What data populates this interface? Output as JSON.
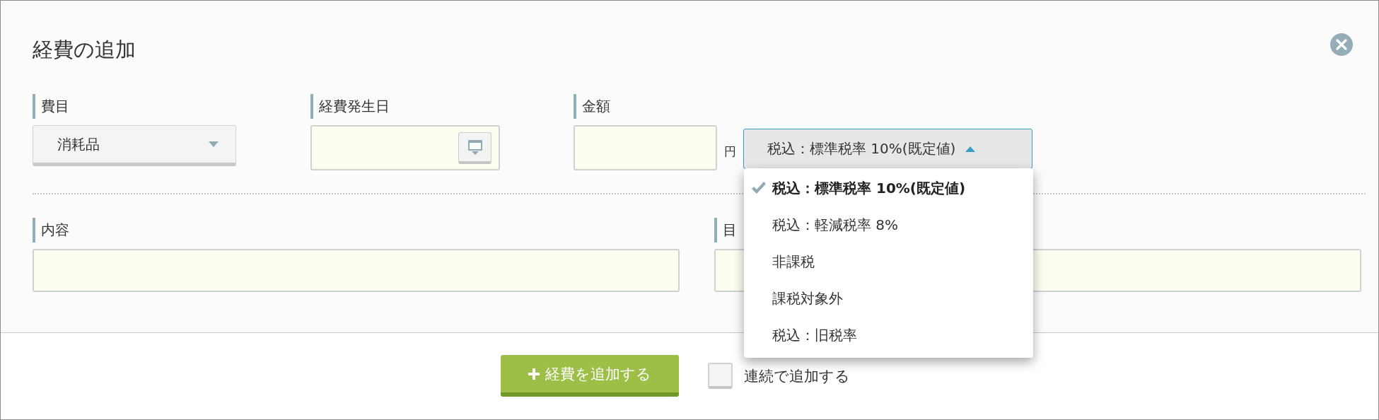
{
  "dialog": {
    "title": "経費の追加",
    "fields": [
      {
        "kind": "select",
        "label": "費目",
        "value": "消耗品"
      },
      {
        "kind": "date",
        "label": "経費発生日"
      },
      {
        "kind": "amount",
        "label": "金額",
        "unit": "円",
        "tax": {
          "value": "税込：標準税率 10%(既定値)",
          "expanded": true,
          "options": [
            {
              "label": "税込：標準税率 10%(既定値)",
              "selected": true
            },
            {
              "label": "税込：軽減税率 8%",
              "selected": false
            },
            {
              "label": "非課税",
              "selected": false
            },
            {
              "label": "課税対象外",
              "selected": false
            },
            {
              "label": "税込：旧税率",
              "selected": false
            }
          ]
        }
      }
    ],
    "fields_2": [
      {
        "kind": "text",
        "label": "内容"
      },
      {
        "kind": "text",
        "label": "目"
      }
    ],
    "footer": {
      "submit": "経費を追加する",
      "continuous": {
        "label": "連続で追加する",
        "checked": false
      }
    }
  }
}
